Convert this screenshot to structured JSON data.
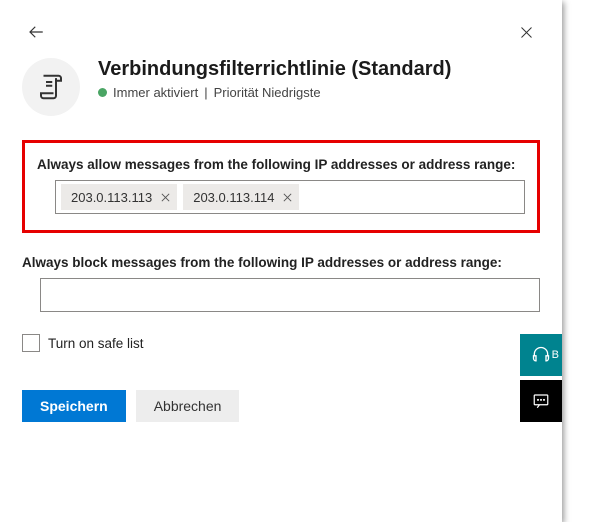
{
  "header": {
    "title": "Verbindungsfilterrichtlinie (Standard)",
    "status": "Immer aktiviert",
    "separator": "|",
    "priority": "Priorität Niedrigste"
  },
  "allow": {
    "label": "Always allow messages from the following IP addresses or address range:",
    "chips": [
      "203.0.113.113",
      "203.0.113.114"
    ]
  },
  "block": {
    "label": "Always block messages from the following IP addresses or address range:",
    "value": ""
  },
  "safelist": {
    "label": "Turn on safe list",
    "checked": false
  },
  "buttons": {
    "save": "Speichern",
    "cancel": "Abbrechen"
  },
  "floaters": {
    "help_extra": "B"
  }
}
